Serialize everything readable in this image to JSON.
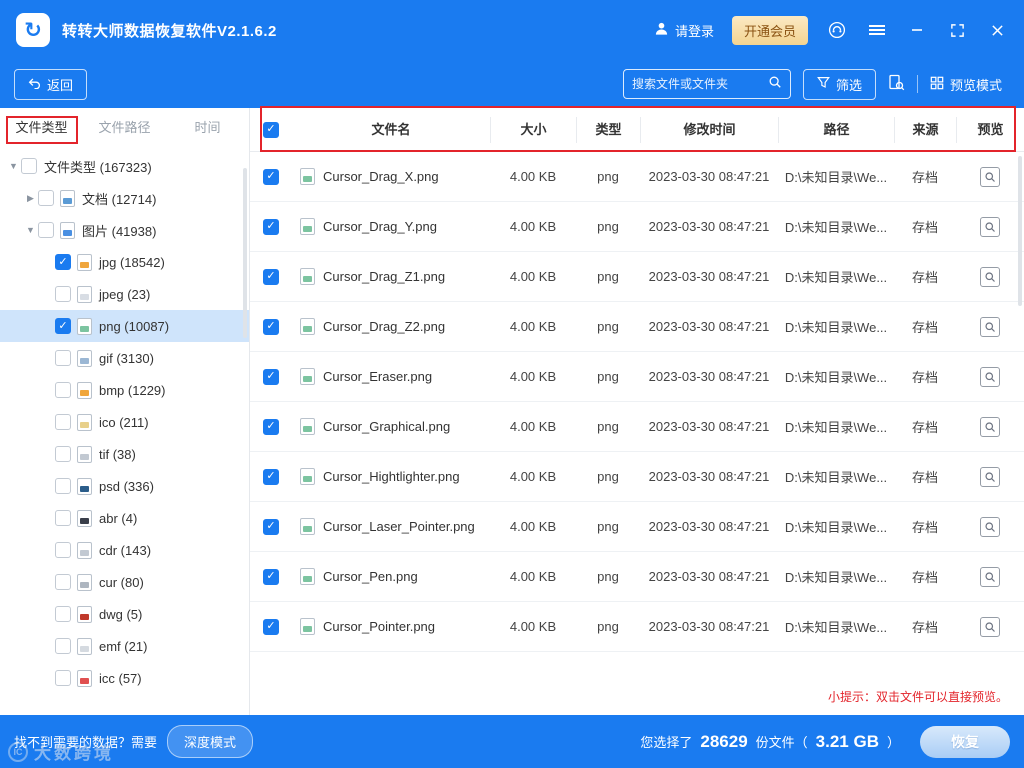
{
  "app": {
    "title": "转转大师数据恢复软件V2.1.6.2",
    "login_label": "请登录",
    "vip_label": "开通会员"
  },
  "toolbar": {
    "back_label": "返回",
    "search_placeholder": "搜索文件或文件夹",
    "filter_label": "筛选",
    "preview_mode_label": "预览模式"
  },
  "sidebar": {
    "tabs": [
      {
        "label": "文件类型",
        "active": true
      },
      {
        "label": "文件路径",
        "active": false
      },
      {
        "label": "时间",
        "active": false
      }
    ],
    "tree": [
      {
        "label": "文件类型 (167323)",
        "level": 0,
        "arrow": "down",
        "checked": false
      },
      {
        "label": "文档 (12714)",
        "level": 1,
        "arrow": "right",
        "checked": false,
        "color": "#5b9bd5"
      },
      {
        "label": "图片 (41938)",
        "level": 1,
        "arrow": "down",
        "checked": false,
        "color": "#4a90e2"
      },
      {
        "label": "jpg (18542)",
        "level": 2,
        "checked": true,
        "color": "#f0a63c"
      },
      {
        "label": "jpeg (23)",
        "level": 2,
        "checked": false,
        "color": "#d8dde4"
      },
      {
        "label": "png (10087)",
        "level": 2,
        "checked": true,
        "selected": true,
        "color": "#7cc4a0"
      },
      {
        "label": "gif (3130)",
        "level": 2,
        "checked": false,
        "color": "#9bb7d4"
      },
      {
        "label": "bmp (1229)",
        "level": 2,
        "checked": false,
        "color": "#f0a63c"
      },
      {
        "label": "ico (211)",
        "level": 2,
        "checked": false,
        "color": "#e8d08a"
      },
      {
        "label": "tif (38)",
        "level": 2,
        "checked": false,
        "color": "#c2c9d2"
      },
      {
        "label": "psd (336)",
        "level": 2,
        "checked": false,
        "color": "#2b5d8a"
      },
      {
        "label": "abr (4)",
        "level": 2,
        "checked": false,
        "color": "#3a3f4a"
      },
      {
        "label": "cdr (143)",
        "level": 2,
        "checked": false,
        "color": "#c2c9d2"
      },
      {
        "label": "cur (80)",
        "level": 2,
        "checked": false,
        "color": "#aeb6c0"
      },
      {
        "label": "dwg (5)",
        "level": 2,
        "checked": false,
        "color": "#c0392b"
      },
      {
        "label": "emf (21)",
        "level": 2,
        "checked": false,
        "color": "#d5dae0"
      },
      {
        "label": "icc (57)",
        "level": 2,
        "checked": false,
        "color": "#e05050"
      }
    ]
  },
  "table": {
    "headers": [
      "文件名",
      "大小",
      "类型",
      "修改时间",
      "路径",
      "来源",
      "预览"
    ],
    "rows": [
      {
        "name": "Cursor_Drag_X.png",
        "size": "4.00 KB",
        "type": "png",
        "modified": "2023-03-30 08:47:21",
        "path": "D:\\未知目录\\We...",
        "source": "存档"
      },
      {
        "name": "Cursor_Drag_Y.png",
        "size": "4.00 KB",
        "type": "png",
        "modified": "2023-03-30 08:47:21",
        "path": "D:\\未知目录\\We...",
        "source": "存档"
      },
      {
        "name": "Cursor_Drag_Z1.png",
        "size": "4.00 KB",
        "type": "png",
        "modified": "2023-03-30 08:47:21",
        "path": "D:\\未知目录\\We...",
        "source": "存档"
      },
      {
        "name": "Cursor_Drag_Z2.png",
        "size": "4.00 KB",
        "type": "png",
        "modified": "2023-03-30 08:47:21",
        "path": "D:\\未知目录\\We...",
        "source": "存档"
      },
      {
        "name": "Cursor_Eraser.png",
        "size": "4.00 KB",
        "type": "png",
        "modified": "2023-03-30 08:47:21",
        "path": "D:\\未知目录\\We...",
        "source": "存档"
      },
      {
        "name": "Cursor_Graphical.png",
        "size": "4.00 KB",
        "type": "png",
        "modified": "2023-03-30 08:47:21",
        "path": "D:\\未知目录\\We...",
        "source": "存档"
      },
      {
        "name": "Cursor_Hightlighter.png",
        "size": "4.00 KB",
        "type": "png",
        "modified": "2023-03-30 08:47:21",
        "path": "D:\\未知目录\\We...",
        "source": "存档"
      },
      {
        "name": "Cursor_Laser_Pointer.png",
        "size": "4.00 KB",
        "type": "png",
        "modified": "2023-03-30 08:47:21",
        "path": "D:\\未知目录\\We...",
        "source": "存档"
      },
      {
        "name": "Cursor_Pen.png",
        "size": "4.00 KB",
        "type": "png",
        "modified": "2023-03-30 08:47:21",
        "path": "D:\\未知目录\\We...",
        "source": "存档"
      },
      {
        "name": "Cursor_Pointer.png",
        "size": "4.00 KB",
        "type": "png",
        "modified": "2023-03-30 08:47:21",
        "path": "D:\\未知目录\\We...",
        "source": "存档"
      }
    ]
  },
  "hint": "小提示：双击文件可以直接预览。",
  "footer": {
    "left_text": "找不到需要的数据？需要",
    "deep_mode_label": "深度模式",
    "selected_prefix": "您选择了",
    "file_count": "28629",
    "mid_text": "份文件（",
    "total_size": "3.21 GB",
    "suffix_text": "）",
    "recover_label": "恢复"
  },
  "watermark": "大数跨境",
  "colors": {
    "primary": "#1a7bf0",
    "annotation_red": "#e3242b",
    "vip_bg": "#f3d491",
    "vip_text": "#8a5212"
  }
}
